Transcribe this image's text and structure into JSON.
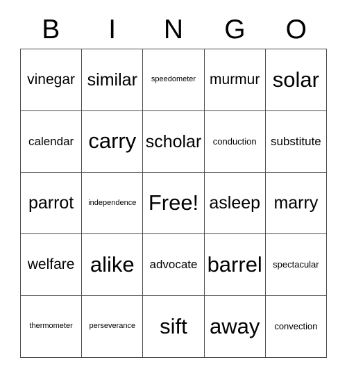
{
  "card": {
    "title": "BINGO Card",
    "header_letters": [
      "B",
      "I",
      "N",
      "G",
      "O"
    ],
    "free_space": {
      "row": 2,
      "col": 2,
      "label": "Free!"
    },
    "grid_size": "5x5",
    "colors": {
      "background": "#ffffff",
      "text": "#000000",
      "grid_line": "#4d4d4d"
    },
    "rows": [
      {
        "cells": [
          {
            "text": "vinegar",
            "size": "t-lg"
          },
          {
            "text": "similar",
            "size": "t-xl"
          },
          {
            "text": "speedometer",
            "size": "t-xs"
          },
          {
            "text": "murmur",
            "size": "t-lg"
          },
          {
            "text": "solar",
            "size": "t-xxl"
          }
        ]
      },
      {
        "cells": [
          {
            "text": "calendar",
            "size": "t-md"
          },
          {
            "text": "carry",
            "size": "t-xxl"
          },
          {
            "text": "scholar",
            "size": "t-xl"
          },
          {
            "text": "conduction",
            "size": "t-sm"
          },
          {
            "text": "substitute",
            "size": "t-md"
          }
        ]
      },
      {
        "cells": [
          {
            "text": "parrot",
            "size": "t-xl"
          },
          {
            "text": "independence",
            "size": "t-xs"
          },
          {
            "text": "Free!",
            "size": "t-xxl"
          },
          {
            "text": "asleep",
            "size": "t-xl"
          },
          {
            "text": "marry",
            "size": "t-xl"
          }
        ]
      },
      {
        "cells": [
          {
            "text": "welfare",
            "size": "t-lg"
          },
          {
            "text": "alike",
            "size": "t-xxl"
          },
          {
            "text": "advocate",
            "size": "t-md"
          },
          {
            "text": "barrel",
            "size": "t-xxl"
          },
          {
            "text": "spectacular",
            "size": "t-sm"
          }
        ]
      },
      {
        "cells": [
          {
            "text": "thermometer",
            "size": "t-xs"
          },
          {
            "text": "perseverance",
            "size": "t-xs"
          },
          {
            "text": "sift",
            "size": "t-xxl"
          },
          {
            "text": "away",
            "size": "t-xxl"
          },
          {
            "text": "convection",
            "size": "t-sm"
          }
        ]
      }
    ]
  }
}
